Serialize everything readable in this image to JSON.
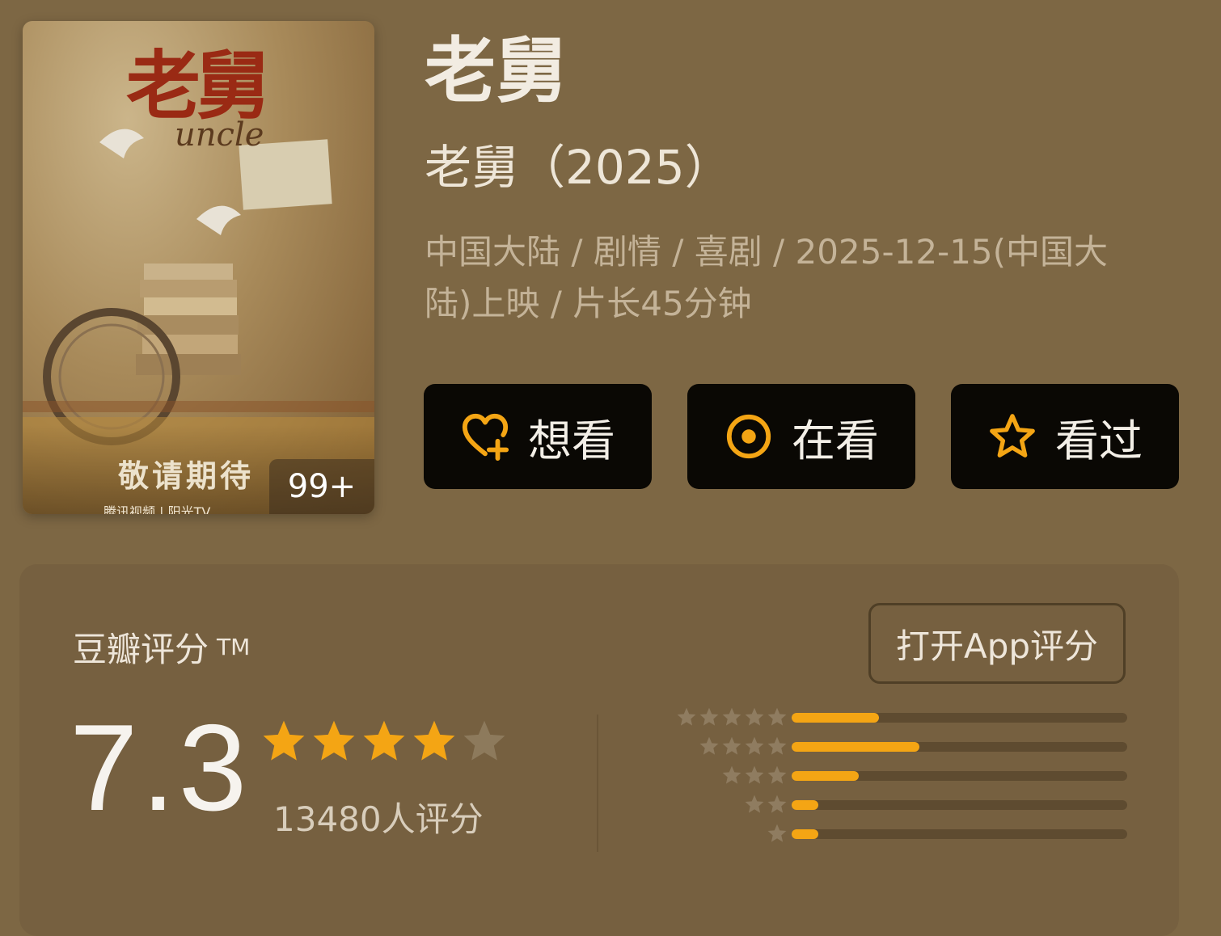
{
  "poster": {
    "title": "老舅",
    "subtitle": "uncle",
    "tagline": "敬请期待",
    "badge": "99+",
    "footer": "腾讯视频 | 阳光TV"
  },
  "header": {
    "title": "老舅",
    "subtitle": "老舅（2025）",
    "meta": "中国大陆 / 剧情 / 喜剧 / 2025-12-15(中国大陆)上映 / 片长45分钟"
  },
  "actions": [
    {
      "label": "想看",
      "icon": "heart-plus-icon"
    },
    {
      "label": "在看",
      "icon": "target-icon"
    },
    {
      "label": "看过",
      "icon": "star-outline-icon"
    }
  ],
  "rating": {
    "title": "豆瓣评分",
    "tm": "TM",
    "open_app": "打开App评分",
    "score": "7.3",
    "count": "13480人评分",
    "stars_filled": 4,
    "stars_total": 5,
    "distribution": [
      {
        "stars": 5,
        "fraction": 0.26
      },
      {
        "stars": 4,
        "fraction": 0.38
      },
      {
        "stars": 3,
        "fraction": 0.2
      },
      {
        "stars": 2,
        "fraction": 0.08
      },
      {
        "stars": 1,
        "fraction": 0.08
      }
    ]
  },
  "colors": {
    "background": "#7d6744",
    "accent": "#f4a514",
    "button_bg": "#0a0804",
    "card_bg": "#766040"
  }
}
